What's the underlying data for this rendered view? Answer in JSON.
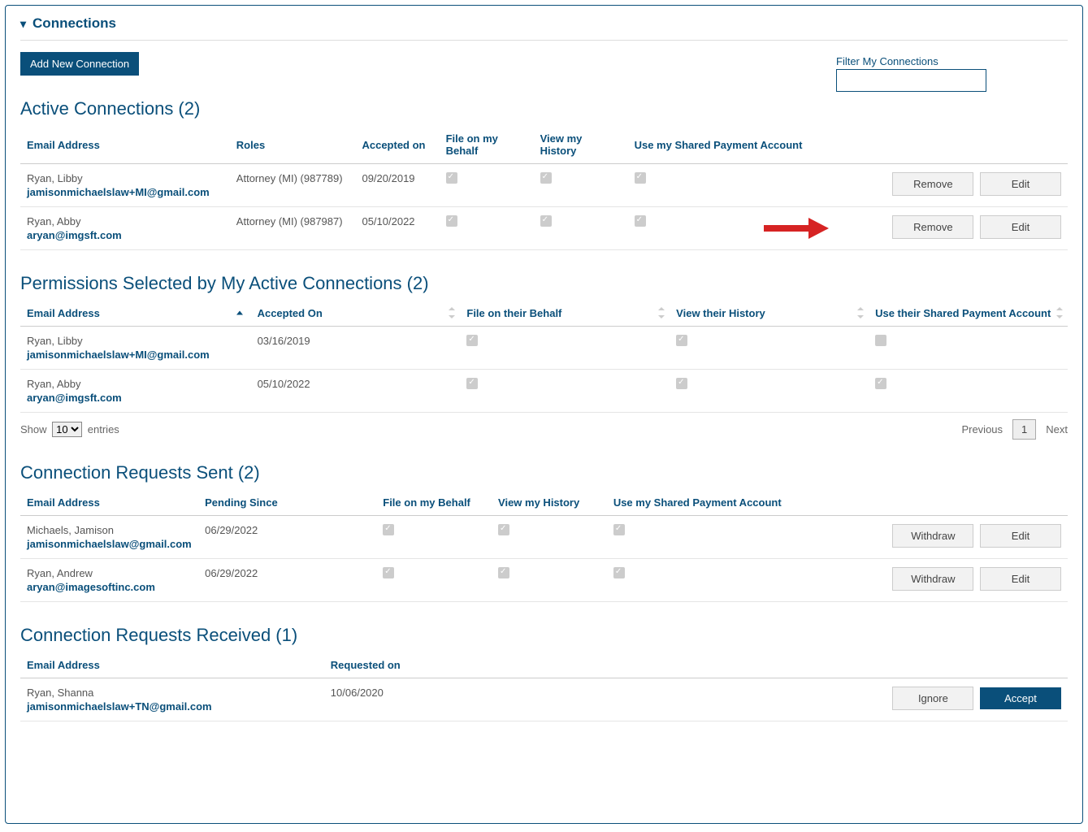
{
  "panel": {
    "title": "Connections"
  },
  "buttons": {
    "add_new": "Add New Connection",
    "remove": "Remove",
    "edit": "Edit",
    "withdraw": "Withdraw",
    "ignore": "Ignore",
    "accept": "Accept"
  },
  "filter": {
    "label": "Filter My Connections"
  },
  "active": {
    "title": "Active Connections (2)",
    "headers": {
      "email": "Email Address",
      "roles": "Roles",
      "accepted": "Accepted on",
      "file": "File on my Behalf",
      "view": "View my History",
      "pay": "Use my Shared Payment Account"
    },
    "rows": [
      {
        "name": "Ryan, Libby",
        "email": "jamisonmichaelslaw+MI@gmail.com",
        "roles": "Attorney (MI) (987789)",
        "accepted": "09/20/2019",
        "file": true,
        "view": true,
        "pay": true
      },
      {
        "name": "Ryan, Abby",
        "email": "aryan@imgsft.com",
        "roles": "Attorney (MI) (987987)",
        "accepted": "05/10/2022",
        "file": true,
        "view": true,
        "pay": true
      }
    ]
  },
  "permissions": {
    "title": "Permissions Selected by My Active Connections (2)",
    "headers": {
      "email": "Email Address",
      "accepted": "Accepted On",
      "file": "File on their Behalf",
      "view": "View their History",
      "pay": "Use their Shared Payment Account"
    },
    "rows": [
      {
        "name": "Ryan, Libby",
        "email": "jamisonmichaelslaw+MI@gmail.com",
        "accepted": "03/16/2019",
        "file": true,
        "view": true,
        "pay": false
      },
      {
        "name": "Ryan, Abby",
        "email": "aryan@imgsft.com",
        "accepted": "05/10/2022",
        "file": true,
        "view": true,
        "pay": true
      }
    ],
    "pager": {
      "show": "Show",
      "entries": "entries",
      "options": "10",
      "previous": "Previous",
      "page": "1",
      "next": "Next"
    }
  },
  "sent": {
    "title": "Connection Requests Sent (2)",
    "headers": {
      "email": "Email Address",
      "pending": "Pending Since",
      "file": "File on my Behalf",
      "view": "View my History",
      "pay": "Use my Shared Payment Account"
    },
    "rows": [
      {
        "name": "Michaels, Jamison",
        "email": "jamisonmichaelslaw@gmail.com",
        "pending": "06/29/2022",
        "file": true,
        "view": true,
        "pay": true
      },
      {
        "name": "Ryan, Andrew",
        "email": "aryan@imagesoftinc.com",
        "pending": "06/29/2022",
        "file": true,
        "view": true,
        "pay": true
      }
    ]
  },
  "received": {
    "title": "Connection Requests Received (1)",
    "headers": {
      "email": "Email Address",
      "requested": "Requested on"
    },
    "rows": [
      {
        "name": "Ryan, Shanna",
        "email": "jamisonmichaelslaw+TN@gmail.com",
        "requested": "10/06/2020"
      }
    ]
  }
}
